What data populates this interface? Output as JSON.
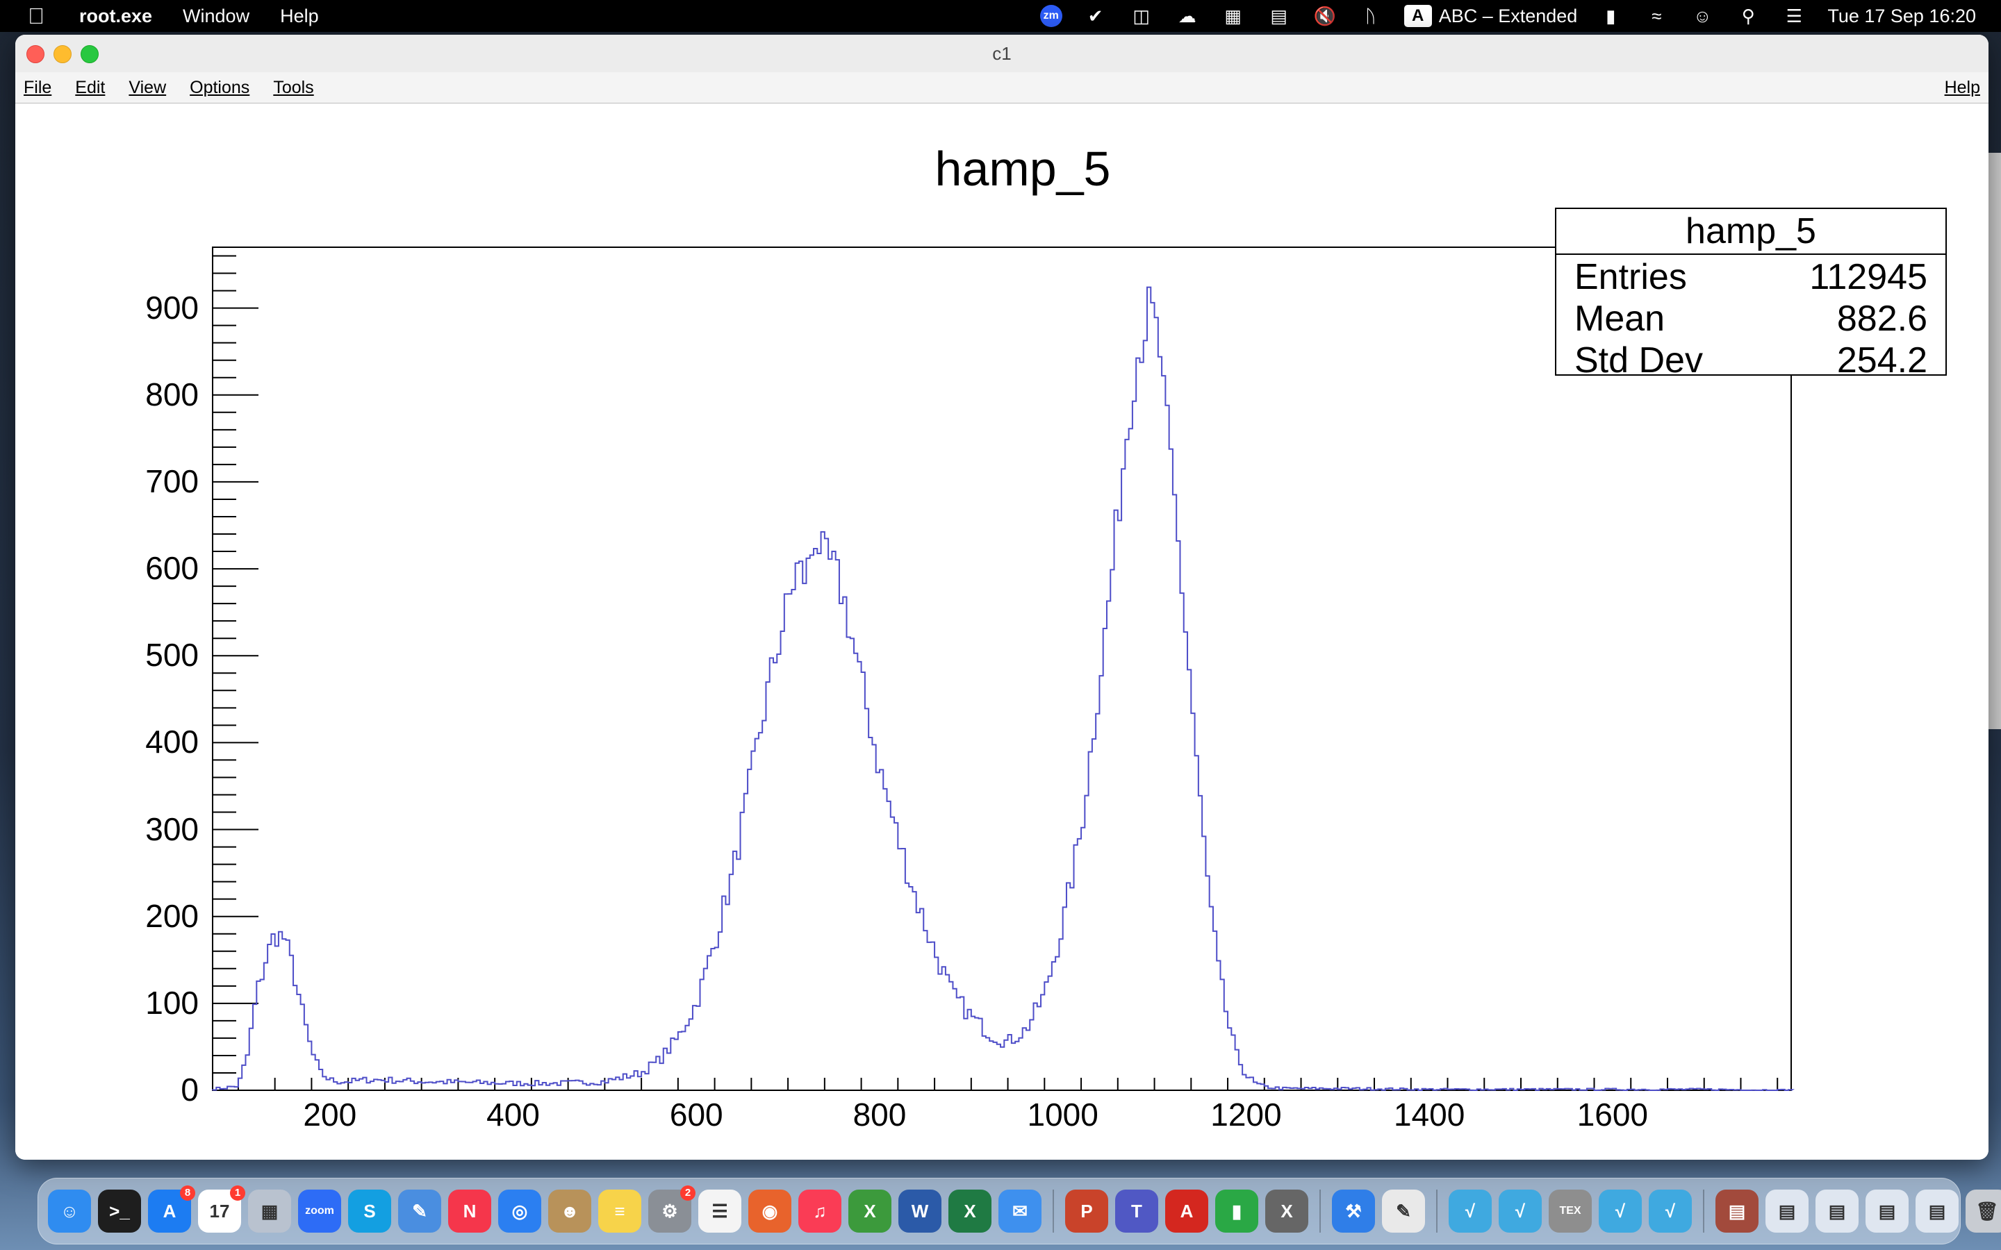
{
  "menubar": {
    "app_name": "root.exe",
    "menus": [
      "Window",
      "Help"
    ],
    "input_source_letter": "A",
    "input_source": "ABC – Extended",
    "clock": "Tue 17 Sep  16:20",
    "zoom_icon_text": "zm",
    "icons": [
      "zoom-icon",
      "checkmark-app-icon",
      "screen-share-icon",
      "cloud-icon",
      "calculator-icon",
      "memory-icon",
      "mute-icon",
      "bluetooth-icon",
      "battery-icon",
      "wifi-icon",
      "user-icon",
      "search-icon",
      "control-center-icon"
    ]
  },
  "window": {
    "title": "c1",
    "menu": {
      "file": "File",
      "edit": "Edit",
      "view": "View",
      "options": "Options",
      "tools": "Tools",
      "help": "Help"
    }
  },
  "stats": {
    "title": "hamp_5",
    "entries_label": "Entries",
    "entries": "112945",
    "mean_label": "Mean",
    "mean": "882.6",
    "stddev_label": "Std Dev",
    "stddev": "254.2"
  },
  "chart_data": {
    "type": "line",
    "style": "step-histogram",
    "title": "hamp_5",
    "xlabel": "",
    "ylabel": "",
    "xlim": [
      72,
      1795
    ],
    "ylim": [
      0,
      970
    ],
    "xticks": [
      200,
      400,
      600,
      800,
      1000,
      1200,
      1400,
      1600
    ],
    "xtick_labels": [
      "200",
      "400",
      "600",
      "800",
      "1000",
      "1200",
      "1400",
      "1600"
    ],
    "yticks": [
      0,
      100,
      200,
      300,
      400,
      500,
      600,
      700,
      800,
      900
    ],
    "ytick_labels": [
      "0",
      "100",
      "200",
      "300",
      "400",
      "500",
      "600",
      "700",
      "800",
      "900"
    ],
    "line_color": "#4d4dc8",
    "series": [
      {
        "x": [
          80,
          100,
          110,
          120,
          130,
          140,
          150,
          160,
          170,
          180,
          190,
          200,
          210,
          220,
          240,
          260,
          300,
          350,
          400,
          450,
          500,
          540,
          560,
          580,
          600,
          620,
          640,
          660,
          680,
          700,
          710,
          720,
          730,
          740,
          750,
          760,
          770,
          780,
          790,
          800,
          820,
          840,
          860,
          880,
          900,
          920,
          940,
          960,
          980,
          1000,
          1020,
          1040,
          1050,
          1060,
          1070,
          1080,
          1090,
          1095,
          1100,
          1105,
          1110,
          1120,
          1130,
          1140,
          1150,
          1160,
          1170,
          1180,
          1190,
          1200,
          1210,
          1220,
          1240,
          1300,
          1400,
          1500,
          1600,
          1700,
          1790
        ],
        "y": [
          2,
          5,
          40,
          110,
          150,
          180,
          175,
          140,
          90,
          45,
          20,
          12,
          10,
          10,
          12,
          12,
          10,
          9,
          8,
          8,
          10,
          20,
          35,
          60,
          100,
          170,
          250,
          360,
          470,
          560,
          600,
          590,
          640,
          610,
          600,
          570,
          520,
          470,
          420,
          370,
          290,
          220,
          160,
          110,
          85,
          65,
          55,
          70,
          110,
          190,
          300,
          470,
          560,
          660,
          760,
          840,
          880,
          900,
          880,
          860,
          800,
          700,
          580,
          460,
          330,
          220,
          140,
          80,
          40,
          18,
          8,
          4,
          2,
          2,
          1,
          1,
          1,
          1,
          0
        ]
      }
    ]
  },
  "dock": {
    "apps": [
      {
        "name": "finder",
        "label": "☺",
        "color": "#2f8cf0"
      },
      {
        "name": "terminal",
        "label": ">_",
        "color": "#1e1e1e"
      },
      {
        "name": "app-store",
        "label": "A",
        "color": "#1c7cf2",
        "badge": "8"
      },
      {
        "name": "calendar",
        "label": "17",
        "color": "#ffffff",
        "badge": "1"
      },
      {
        "name": "launchpad",
        "label": "▦",
        "color": "#b9c2cf"
      },
      {
        "name": "zoom",
        "label": "zoom",
        "color": "#2d6cf6"
      },
      {
        "name": "skype",
        "label": "S",
        "color": "#139fe1"
      },
      {
        "name": "freeform",
        "label": "✎",
        "color": "#4a8ee0"
      },
      {
        "name": "news",
        "label": "N",
        "color": "#f5364b"
      },
      {
        "name": "safari",
        "label": "◎",
        "color": "#2b7ff1"
      },
      {
        "name": "contacts",
        "label": "☻",
        "color": "#b8925a"
      },
      {
        "name": "notes",
        "label": "≡",
        "color": "#f7d34a"
      },
      {
        "name": "system-settings",
        "label": "⚙",
        "color": "#8a8f96",
        "badge": "2"
      },
      {
        "name": "reminders",
        "label": "☰",
        "color": "#f4f4f4"
      },
      {
        "name": "firefox",
        "label": "◉",
        "color": "#e8632c"
      },
      {
        "name": "music",
        "label": "♫",
        "color": "#fa3c55"
      },
      {
        "name": "xquartz",
        "label": "X",
        "color": "#3c9a3c"
      },
      {
        "name": "word",
        "label": "W",
        "color": "#2b5aa8"
      },
      {
        "name": "excel",
        "label": "X",
        "color": "#1f7a43"
      },
      {
        "name": "mail",
        "label": "✉",
        "color": "#3e90ee"
      },
      {
        "name": "powerpoint",
        "label": "P",
        "color": "#c9432a"
      },
      {
        "name": "teams",
        "label": "T",
        "color": "#5058c4"
      },
      {
        "name": "acrobat",
        "label": "A",
        "color": "#d4271f"
      },
      {
        "name": "numbers",
        "label": "▮",
        "color": "#2aa845"
      },
      {
        "name": "x11",
        "label": "X",
        "color": "#666666"
      },
      {
        "name": "xcode",
        "label": "⚒",
        "color": "#2f7ee8"
      },
      {
        "name": "textedit",
        "label": "✎",
        "color": "#e9e9e9"
      },
      {
        "name": "root-1",
        "label": "√",
        "color": "#3fa9e0"
      },
      {
        "name": "root-2",
        "label": "√",
        "color": "#3fa9e0"
      },
      {
        "name": "tex",
        "label": "TEX",
        "color": "#8e8e8e"
      },
      {
        "name": "root-3",
        "label": "√",
        "color": "#3fa9e0"
      },
      {
        "name": "root-4",
        "label": "√",
        "color": "#3fa9e0"
      },
      {
        "name": "doc-stack-1",
        "label": "▤",
        "color": "#a24a3c"
      },
      {
        "name": "doc-stack-2",
        "label": "▤",
        "color": "#dfe6f0"
      },
      {
        "name": "doc-stack-3",
        "label": "▤",
        "color": "#dfe6f0"
      },
      {
        "name": "doc-stack-4",
        "label": "▤",
        "color": "#dfe6f0"
      },
      {
        "name": "doc-stack-5",
        "label": "▤",
        "color": "#dfe6f0"
      },
      {
        "name": "trash",
        "label": "🗑",
        "color": "#c8ccd2"
      }
    ]
  }
}
